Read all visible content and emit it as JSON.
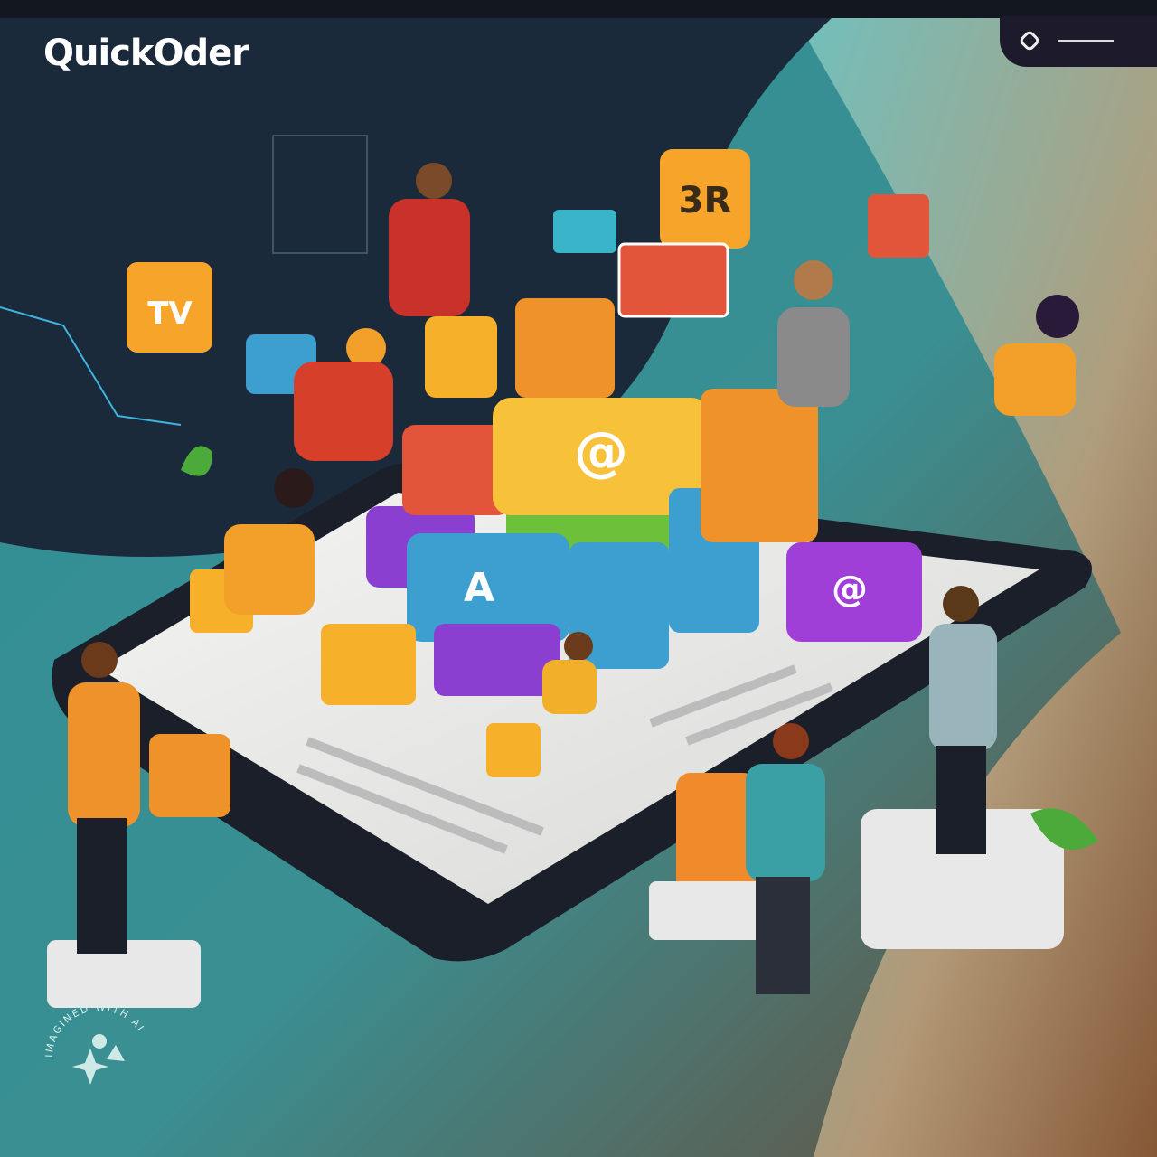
{
  "brand": {
    "name": "QuickOder"
  },
  "badges": {
    "top_block": "3R",
    "left_block": "TV",
    "center_block": "@",
    "blue_block": "A",
    "purple_block": "@"
  },
  "watermark": {
    "text": "IMAGINED WITH AI"
  },
  "colors": {
    "dark_bg": "#1b2a3a",
    "teal_bg": "#3aa3a6",
    "orange": "#f2a02a",
    "red": "#e2553b",
    "green": "#6cc03a",
    "purple": "#8a3fd0",
    "blue": "#3d9fcf",
    "yellow": "#f7c13a"
  }
}
